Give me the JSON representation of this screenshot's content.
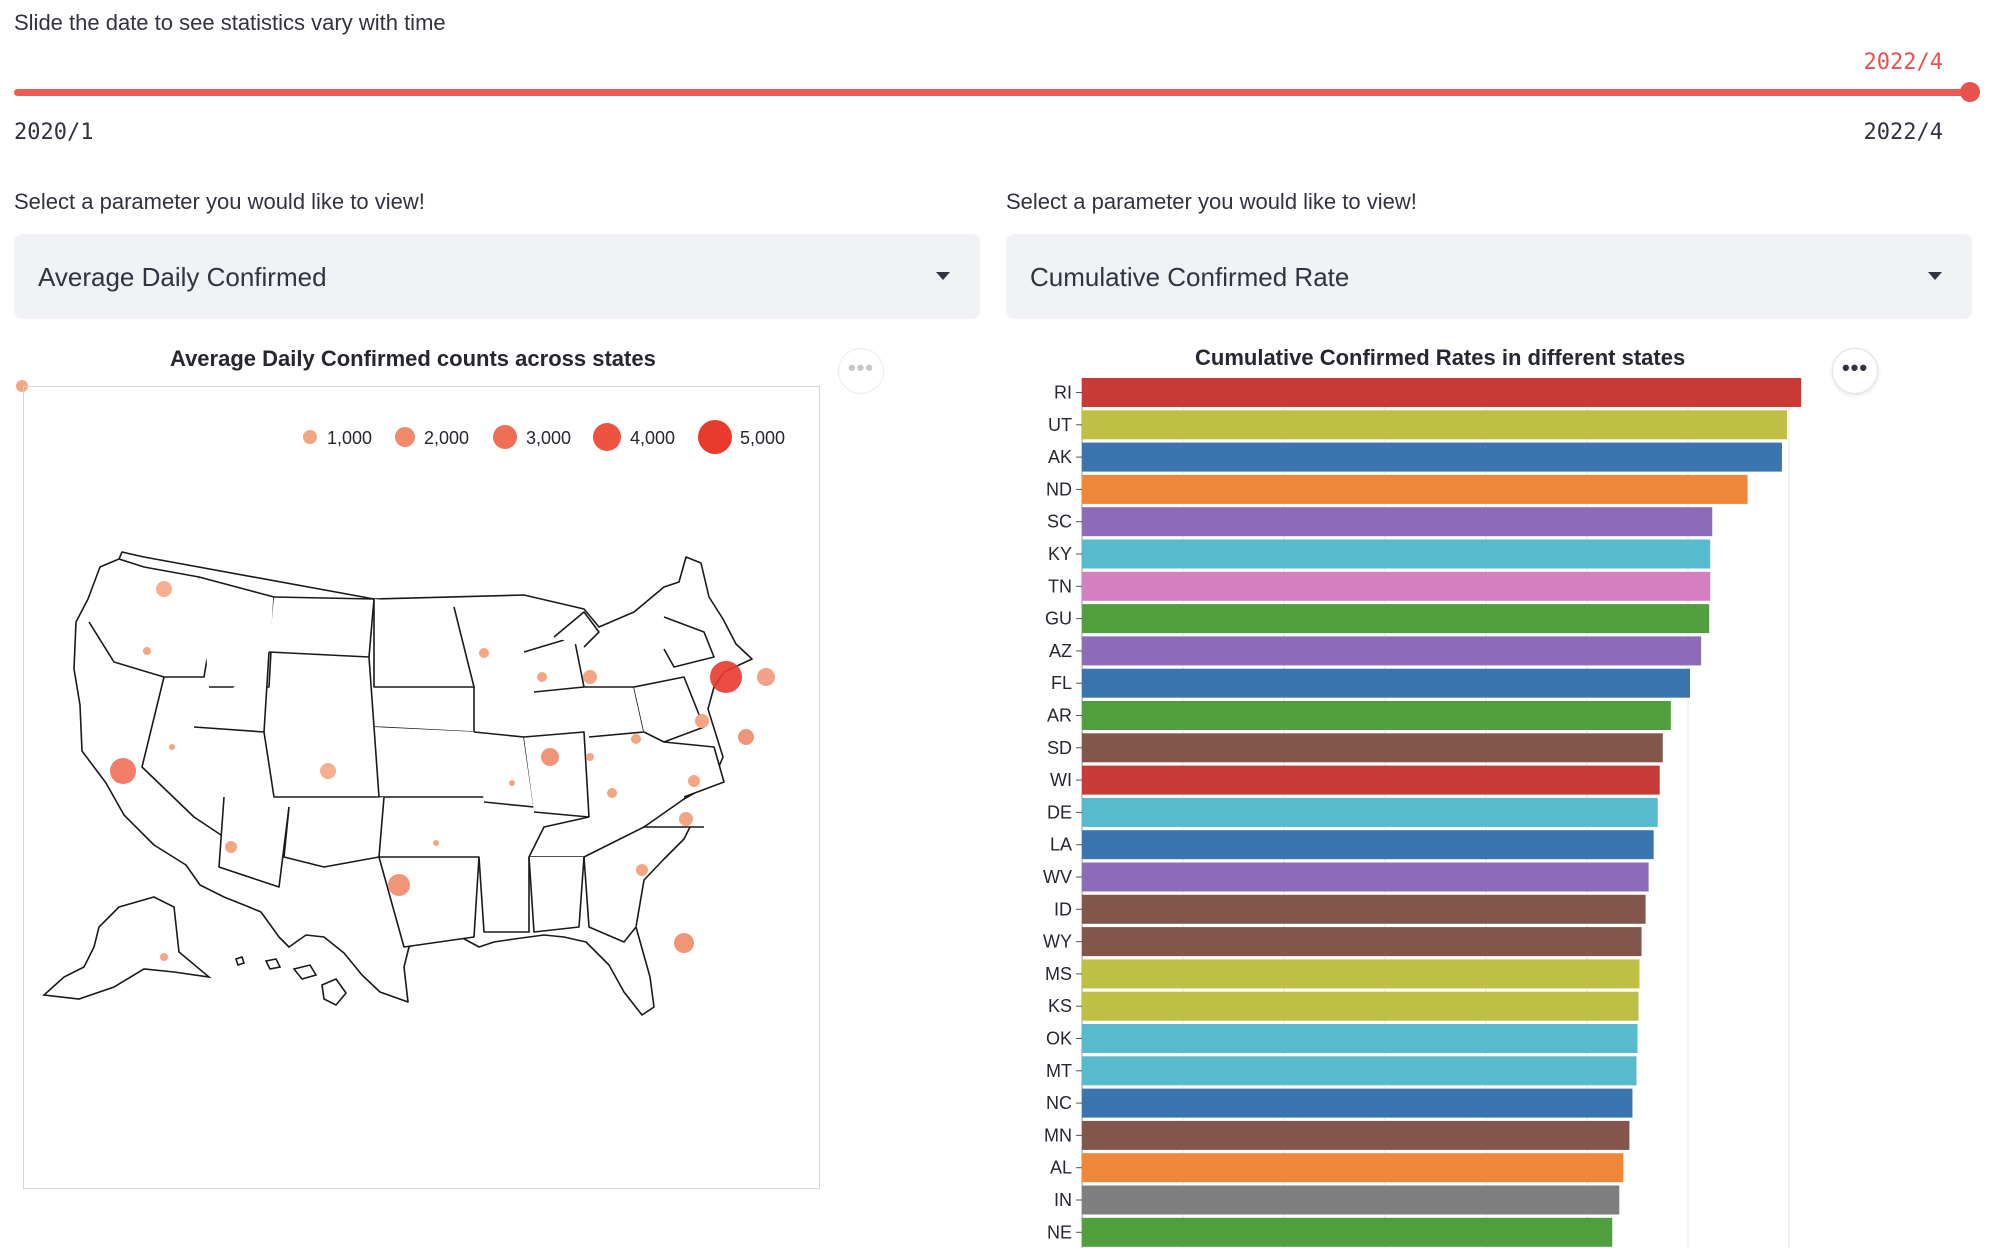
{
  "slider": {
    "caption": "Slide the date to see statistics vary with time",
    "value": "2022/4",
    "min_label": "2020/1",
    "max_label": "2022/4",
    "accent_color": "#e9514f"
  },
  "left_select": {
    "label": "Select a parameter you would like to view!",
    "value": "Average Daily Confirmed"
  },
  "right_select": {
    "label": "Select a parameter you would like to view!",
    "value": "Cumulative Confirmed Rate"
  },
  "icons": {
    "more": "more-horizontal-icon",
    "select_caret": "chevron-down-icon"
  },
  "map_chart": {
    "title": "Average Daily Confirmed counts across states",
    "legend": [
      "1,000",
      "2,000",
      "3,000",
      "4,000",
      "5,000"
    ],
    "legend_colors": [
      "#f4a582",
      "#f08a6a",
      "#ef6f55",
      "#ed5340",
      "#e93a2d"
    ]
  },
  "chart_data": {
    "type": "bar",
    "title": "Cumulative Confirmed Rates in different states",
    "xlabel": "",
    "ylabel": "",
    "orientation": "horizontal",
    "grid": true,
    "categories": [
      "RI",
      "UT",
      "AK",
      "ND",
      "SC",
      "KY",
      "TN",
      "GU",
      "AZ",
      "FL",
      "AR",
      "SD",
      "WI",
      "DE",
      "LA",
      "WV",
      "ID",
      "WY",
      "MS",
      "KS",
      "OK",
      "MT",
      "NC",
      "MN",
      "AL",
      "IN",
      "NE"
    ],
    "values": [
      0.712,
      0.698,
      0.693,
      0.659,
      0.624,
      0.622,
      0.622,
      0.621,
      0.613,
      0.602,
      0.583,
      0.575,
      0.572,
      0.57,
      0.566,
      0.561,
      0.558,
      0.554,
      0.552,
      0.551,
      0.55,
      0.549,
      0.545,
      0.542,
      0.536,
      0.532,
      0.525
    ],
    "colors": [
      "#c73a35",
      "#bfbf45",
      "#3a75b0",
      "#f0863a",
      "#8d6bb8",
      "#57bacd",
      "#d37fc0",
      "#519e3e",
      "#8d6bb8",
      "#3a75b0",
      "#519e3e",
      "#83564b",
      "#c73a35",
      "#57bacd",
      "#3a75b0",
      "#8d6bb8",
      "#83564b",
      "#83564b",
      "#bfbf45",
      "#bfbf45",
      "#57bacd",
      "#57bacd",
      "#3a75b0",
      "#83564b",
      "#f0863a",
      "#7f7f7f",
      "#519e3e"
    ]
  }
}
